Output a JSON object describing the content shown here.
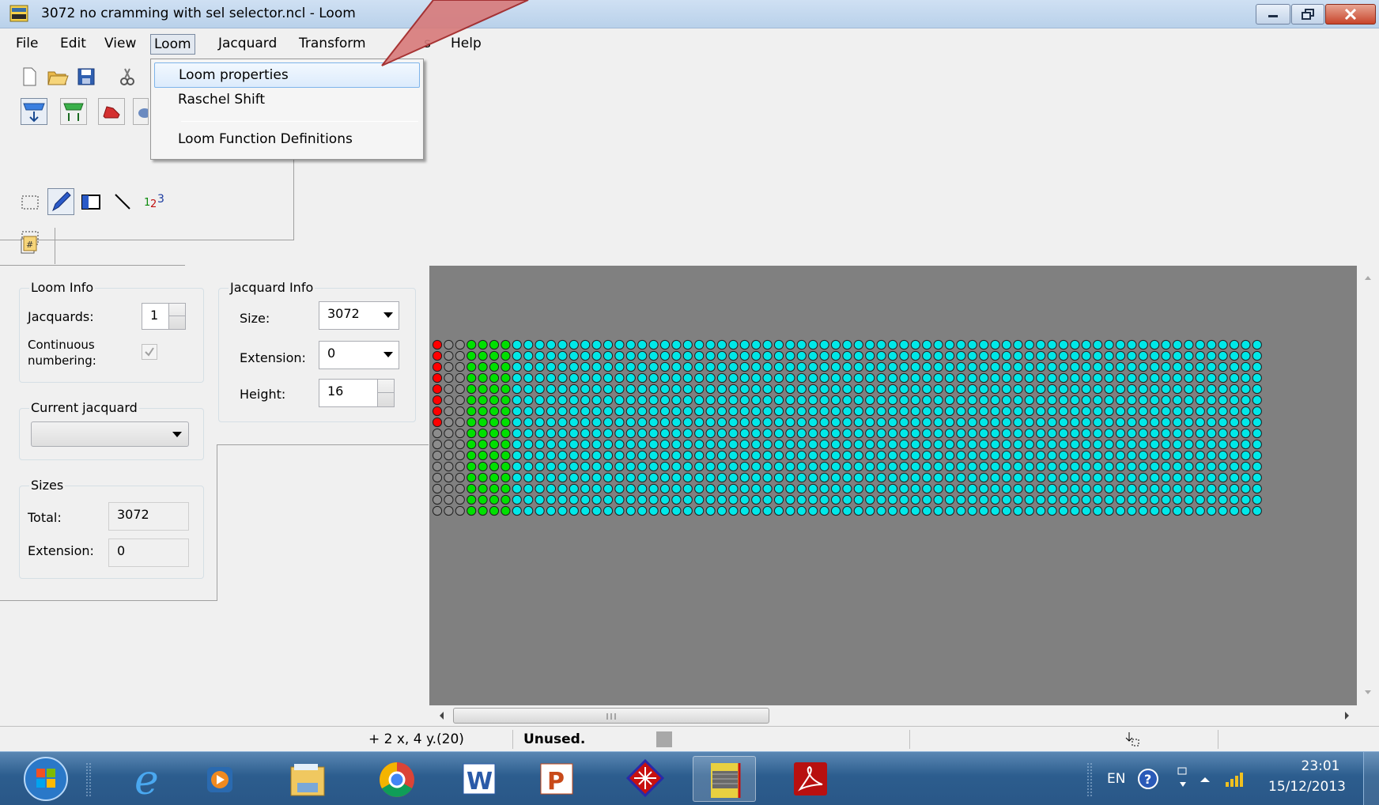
{
  "window": {
    "title": "3072 no cramming with sel selector.ncl - Loom"
  },
  "menubar": {
    "file": "File",
    "edit": "Edit",
    "view": "View",
    "loom": "Loom",
    "jacquard": "Jacquard",
    "transform": "Transform",
    "tools_partial": "s",
    "help": "Help"
  },
  "loom_menu": {
    "items": [
      "Loom properties",
      "Raschel Shift",
      "Loom Function Definitions"
    ],
    "highlighted": "Loom properties"
  },
  "loom_info": {
    "title": "Loom Info",
    "jacquards_label": "Jacquards:",
    "jacquards_value": "1",
    "continuous_label_1": "Continuous",
    "continuous_label_2": "numbering:",
    "continuous_checked": true
  },
  "jacquard_info": {
    "title": "Jacquard Info",
    "size_label": "Size:",
    "size_value": "3072",
    "extension_label": "Extension:",
    "extension_value": "0",
    "height_label": "Height:",
    "height_value": "16"
  },
  "current_jacquard": {
    "title": "Current jacquard",
    "value": ""
  },
  "sizes": {
    "title": "Sizes",
    "total_label": "Total:",
    "total_value": "3072",
    "extension_label": "Extension:",
    "extension_value": "0"
  },
  "grid": {
    "rows": 16,
    "cols": 73,
    "red_rows": 8,
    "gray_cols": 3,
    "green_cols": 4,
    "colors": {
      "red": "#ff0000",
      "gray": "#8c8c8c",
      "green": "#00e000",
      "cyan": "#00e8e8",
      "background": "#808080"
    }
  },
  "statusbar": {
    "position": "+ 2 x, 4 y.(20)",
    "state": "Unused."
  },
  "taskbar": {
    "language": "EN",
    "time": "23:01",
    "date": "15/12/2013",
    "apps": [
      "start-orb",
      "internet-explorer",
      "media-player",
      "file-explorer",
      "chrome",
      "word",
      "powerpoint",
      "loom-app",
      "jacquard-app",
      "acrobat"
    ]
  },
  "accent": {
    "arrow": "#d26a6a",
    "menu_highlight": "#cce4f7"
  }
}
